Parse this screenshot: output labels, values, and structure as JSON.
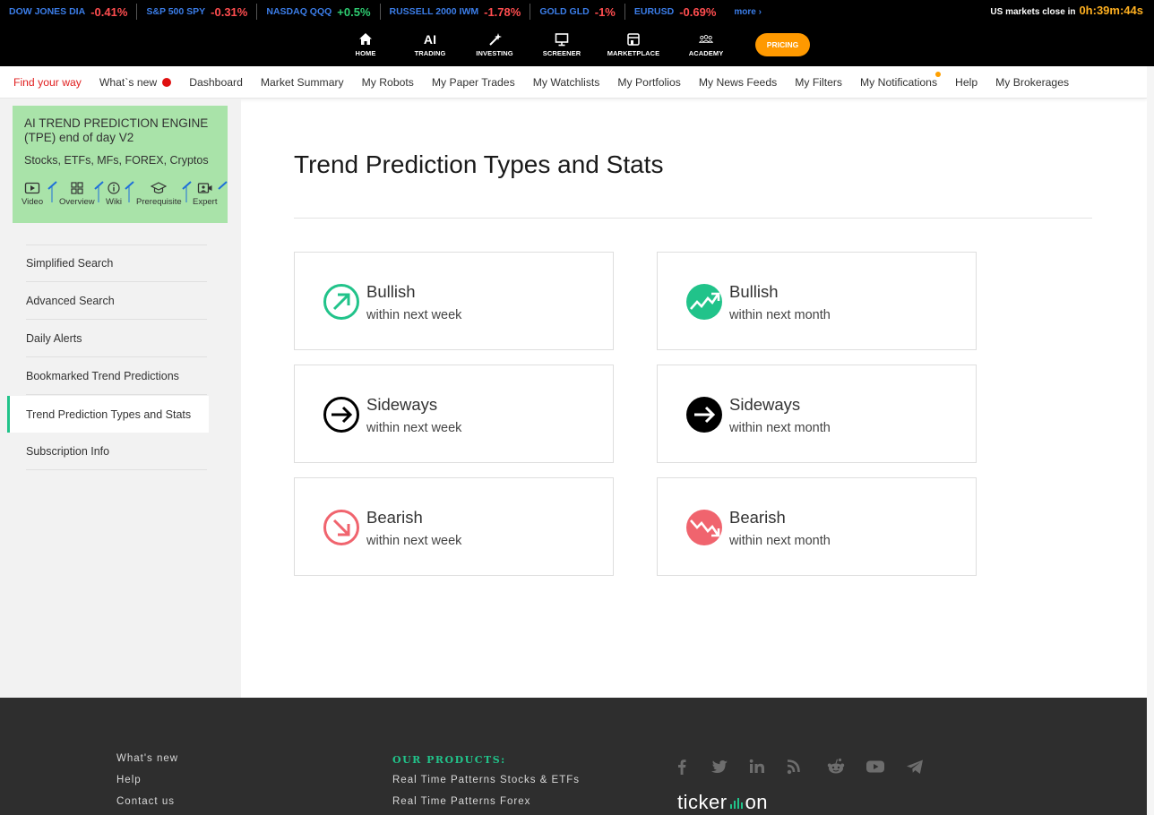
{
  "ticker": {
    "items": [
      {
        "name": "DOW JONES DIA",
        "change": "-0.41%",
        "dir": "neg"
      },
      {
        "name": "S&P 500 SPY",
        "change": "-0.31%",
        "dir": "neg"
      },
      {
        "name": "NASDAQ QQQ",
        "change": "+0.5%",
        "dir": "pos"
      },
      {
        "name": "RUSSELL 2000 IWM",
        "change": "-1.78%",
        "dir": "neg"
      },
      {
        "name": "GOLD GLD",
        "change": "-1%",
        "dir": "neg"
      },
      {
        "name": "EURUSD",
        "change": "-0.69%",
        "dir": "neg"
      }
    ],
    "more": "more ›",
    "close_label": "US markets close in",
    "countdown": "0h:39m:44s"
  },
  "mainnav": {
    "home": "HOME",
    "ai_glyph": "AI",
    "trading": "TRADING",
    "investing": "INVESTING",
    "screener": "SCREENER",
    "marketplace": "MARKETPLACE",
    "academy": "ACADEMY",
    "pricing": "PRICING"
  },
  "subnav": {
    "find": "Find your way",
    "whatsnew": "What`s new",
    "dashboard": "Dashboard",
    "market_summary": "Market Summary",
    "robots": "My Robots",
    "paper_trades": "My Paper Trades",
    "watchlists": "My Watchlists",
    "portfolios": "My Portfolios",
    "news_feeds": "My News Feeds",
    "filters": "My Filters",
    "notifications": "My Notifications",
    "help": "Help",
    "brokerages": "My Brokerages"
  },
  "sidebar": {
    "product_title": "AI TREND PREDICTION ENGINE (TPE) end of day V2",
    "product_sub": "Stocks, ETFs, MFs, FOREX, Cryptos",
    "links": {
      "video": "Video",
      "overview": "Overview",
      "wiki": "Wiki",
      "prerequisite": "Prerequisite",
      "expert": "Expert"
    },
    "menu": {
      "simplified": "Simplified Search",
      "advanced": "Advanced Search",
      "alerts": "Daily Alerts",
      "bookmarked": "Bookmarked Trend Predictions",
      "types": "Trend Prediction Types and Stats",
      "subscription": "Subscription Info"
    }
  },
  "main": {
    "title": "Trend Prediction Types and Stats",
    "cards": [
      {
        "label": "Bullish",
        "period": "within next week"
      },
      {
        "label": "Bullish",
        "period": "within next month"
      },
      {
        "label": "Sideways",
        "period": "within next week"
      },
      {
        "label": "Sideways",
        "period": "within next month"
      },
      {
        "label": "Bearish",
        "period": "within next week"
      },
      {
        "label": "Bearish",
        "period": "within next month"
      }
    ]
  },
  "footer": {
    "whatsnew": "What's new",
    "help": "Help",
    "contact": "Contact us",
    "products_heading": "OUR PRODUCTS:",
    "product1": "Real Time Patterns Stocks & ETFs",
    "product2": "Real Time Patterns Forex",
    "brand_left": "ticker",
    "brand_right": "on"
  },
  "colors": {
    "accent_green": "#21c38a",
    "bearish_red": "#f0646e",
    "pricing_orange": "#ff9900",
    "product_card_green": "#a9e3a9",
    "ticker_blue": "#3b7de8"
  },
  "icons": [
    "home-icon",
    "magic-wand-icon",
    "monitor-icon",
    "store-icon",
    "people-icon",
    "play-video-icon",
    "grid-icon",
    "info-icon",
    "graduation-cap-icon",
    "video-camera-icon",
    "facebook-icon",
    "twitter-icon",
    "linkedin-icon",
    "rss-icon",
    "reddit-icon",
    "youtube-icon",
    "telegram-icon"
  ]
}
